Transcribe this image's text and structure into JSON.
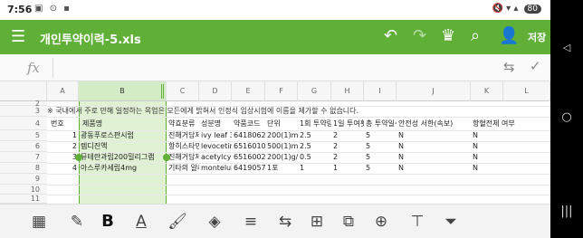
{
  "status": {
    "time": "7:56",
    "left_icons": "▣ ⊙ ▪",
    "right_icons": "🔇 ▾ ▴",
    "battery": "80"
  },
  "appbar": {
    "title": "개인투약이력-5.xls",
    "save_label": "저장"
  },
  "formula": {
    "fx": "fx",
    "value": ""
  },
  "columns": [
    "A",
    "B",
    "C",
    "D",
    "E",
    "F",
    "G",
    "H",
    "I",
    "J",
    "K",
    "L"
  ],
  "row_numbers": [
    "2",
    "3",
    "4",
    "5",
    "6",
    "7",
    "8",
    "9",
    "10",
    "11"
  ],
  "row2_note": "※ 국내에서 주로 만해 일정하는 목업은 모든에게 밝혀서 인정식 임상시험에 이름을 제가할 수 없습니다.",
  "header_row": [
    "번호",
    "제품명",
    "약효분류",
    "성분명",
    "약품코드",
    "단위",
    "1회 투약량",
    "1일 투여횟수",
    "총 투약일수",
    "안전성 서한(속보)",
    "항혈전제 여부"
  ],
  "rows": [
    [
      "1",
      "광동푸로스판시럽",
      "진해거담제",
      "ivy leaf 30",
      "641806241",
      "200(1)mL/병",
      "2.5",
      "2",
      "5",
      "N",
      "N"
    ],
    [
      "2",
      "렙디진액",
      "항히스타민",
      "levocetirizi",
      "651601032",
      "500(1)mL/병",
      "2.5",
      "2",
      "5",
      "N",
      "N"
    ],
    [
      "3",
      "뮤테란과립200밀리그램",
      "진해거담제",
      "acetylcyste",
      "651600235",
      "200(1)g/봉",
      "0.5",
      "2",
      "5",
      "N",
      "N"
    ],
    [
      "4",
      "아스루카세립4mg",
      "기타의 알레",
      "monteluka",
      "641905741",
      "1포",
      "1",
      "1",
      "5",
      "N",
      "N"
    ]
  ]
}
